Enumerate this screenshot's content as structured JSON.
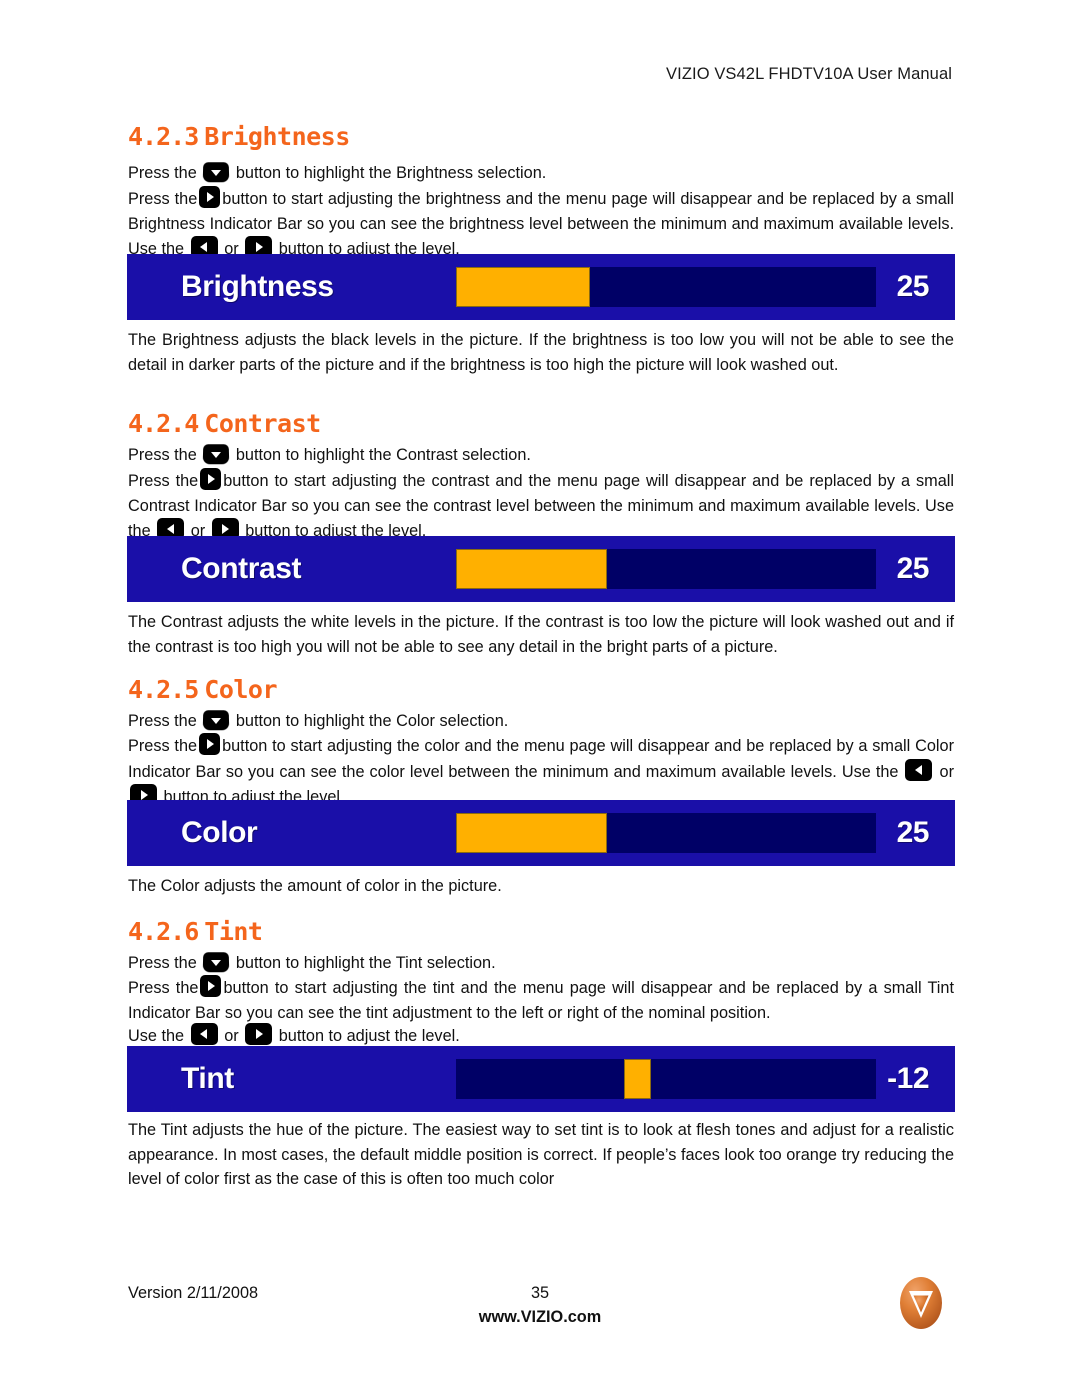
{
  "document": {
    "running_header": "VIZIO VS42L FHDTV10A User Manual",
    "page_number": "35",
    "version": "Version 2/11/2008",
    "website": "www.VIZIO.com",
    "logo_name": "vizio-logo"
  },
  "colors": {
    "heading_orange": "#f4651c",
    "osd_panel_blue": "#1a0fa8",
    "osd_track_blue": "#000066",
    "osd_fill_orange": "#ffb000",
    "logo_orange": "#d9722e",
    "body_text": "#111111"
  },
  "sections": [
    {
      "number": "4.2.3",
      "title": "Brightness",
      "para1_a": "Press the",
      "para1_b": "button to highlight the Brightness selection.",
      "para2_a": "Press the",
      "para2_b": "button to start adjusting the brightness and the menu page will disappear and be replaced by a small Brightness Indicator Bar so you can see the brightness level between the minimum and maximum available levels.  Use the",
      "para2_c": "or",
      "para2_d": "button to adjust the level.",
      "osd": {
        "label": "Brightness",
        "value": "25",
        "fill_percent": 32,
        "type": "fill"
      },
      "para3": "The Brightness adjusts the black levels in the picture.  If the brightness is too low you will not be able to see the detail in darker parts of the picture and if the brightness is too high the picture will look washed out."
    },
    {
      "number": "4.2.4",
      "title": "Contrast",
      "para1_a": "Press the",
      "para1_b": "button to highlight the Contrast selection.",
      "para2_a": "Press the",
      "para2_b": "button to start adjusting the contrast and the menu page will disappear and be replaced by a small Contrast Indicator Bar so you can see the contrast level between the minimum and maximum available levels.  Use the",
      "para2_c": "or",
      "para2_d": "button to adjust the level.",
      "osd": {
        "label": "Contrast",
        "value": "25",
        "fill_percent": 36,
        "type": "fill"
      },
      "para3": "The Contrast adjusts the white levels in the picture.  If the contrast is too low the picture will look washed out and if the contrast is too high you will not be able to see any detail in the bright parts of a picture."
    },
    {
      "number": "4.2.5",
      "title": "Color",
      "para1_a": "Press the",
      "para1_b": "button to highlight the Color selection.",
      "para2_a": "Press the",
      "para2_b": "button to start adjusting the color and the menu page will disappear and be replaced by a small Color Indicator Bar so you can see the color level between the minimum and maximum available levels.  Use the",
      "para2_c": "or",
      "para2_d": "button to adjust the level.",
      "osd": {
        "label": "Color",
        "value": "25",
        "fill_percent": 36,
        "type": "fill"
      },
      "para3": "The Color adjusts the amount of color in the picture."
    },
    {
      "number": "4.2.6",
      "title": "Tint",
      "para1_a": "Press the",
      "para1_b": "button to highlight the Tint selection.",
      "para2_a": "Press the",
      "para2_b": "button to start adjusting the tint and the menu page will disappear and be replaced by a small Tint Indicator Bar so you can see the tint adjustment to the left or right of the nominal position.",
      "para2_c": "Use the",
      "para2_d": "or",
      "para2_e": "button to adjust the level.",
      "osd": {
        "label": "Tint",
        "value": "-12",
        "marker_left_percent": 40,
        "marker_width_percent": 6.5,
        "type": "marker"
      },
      "para3": "The Tint adjusts the hue of the picture.  The easiest way to set tint is to look at flesh tones and adjust for a realistic appearance.  In most cases, the default middle position is correct.  If people’s faces look too orange try reducing the level of color first as the case of this is often too much color"
    }
  ]
}
